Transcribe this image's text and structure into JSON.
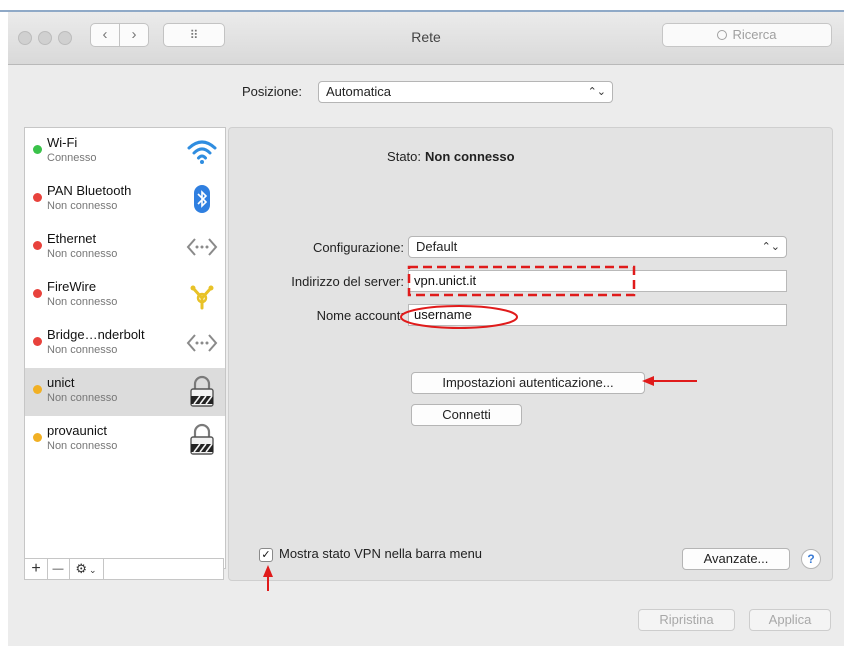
{
  "window": {
    "title": "Rete"
  },
  "toolbar": {
    "back": "‹",
    "forward": "›",
    "grid": "⠿",
    "search_placeholder": "Ricerca"
  },
  "location": {
    "label": "Posizione:",
    "value": "Automatica"
  },
  "services": [
    {
      "name": "Wi-Fi",
      "status": "Connesso",
      "dot": "#3ac24a",
      "icon": "wifi-icon"
    },
    {
      "name": "PAN Bluetooth",
      "status": "Non connesso",
      "dot": "#e8423c",
      "icon": "bluetooth-icon"
    },
    {
      "name": "Ethernet",
      "status": "Non connesso",
      "dot": "#e8423c",
      "icon": "ethernet-icon"
    },
    {
      "name": "FireWire",
      "status": "Non connesso",
      "dot": "#e8423c",
      "icon": "firewire-icon"
    },
    {
      "name": "Bridge…nderbolt",
      "status": "Non connesso",
      "dot": "#e8423c",
      "icon": "thunderbolt-bridge-icon"
    },
    {
      "name": "unict",
      "status": "Non connesso",
      "dot": "#f1b024",
      "icon": "vpn-lock-icon"
    },
    {
      "name": "provaunict",
      "status": "Non connesso",
      "dot": "#f1b024",
      "icon": "vpn-lock-icon"
    }
  ],
  "sidebar_tools": {
    "add": "+",
    "remove": "—",
    "gear": "⚙"
  },
  "detail": {
    "status_label": "Stato:",
    "status_value": "Non connesso",
    "config_label": "Configurazione:",
    "config_value": "Default",
    "server_label": "Indirizzo del server:",
    "server_value": "vpn.unict.it",
    "account_label": "Nome account:",
    "account_value": "username",
    "auth_button": "Impostazioni autenticazione...",
    "connect_button": "Connetti",
    "show_vpn_label": "Mostra stato VPN nella barra menu",
    "show_vpn_checked": "✓",
    "advanced_button": "Avanzate...",
    "help": "?"
  },
  "footer": {
    "revert": "Ripristina",
    "apply": "Applica"
  },
  "colors": {
    "annotation": "#e01b1b",
    "accent": "#3a7bd5"
  }
}
